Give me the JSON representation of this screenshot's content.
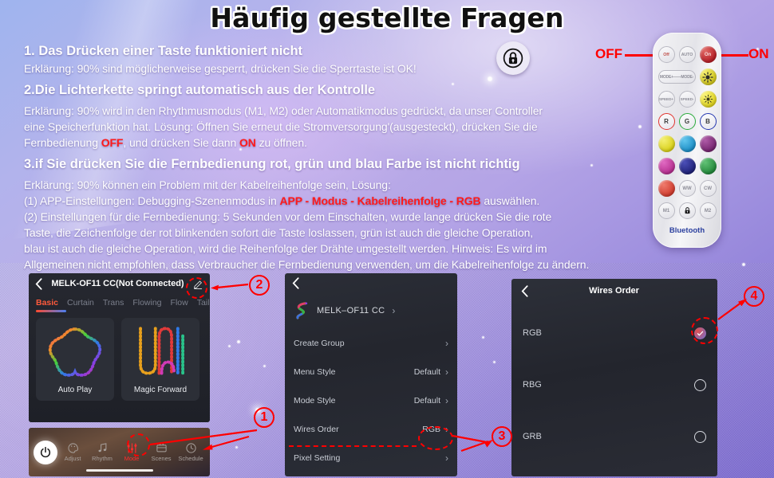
{
  "title": "Häufig gestellte Fragen",
  "faq": [
    {
      "heading": "1. Das Drücken einer Taste funktioniert nicht",
      "body": [
        "Erklärung: 90% sind möglicherweise gesperrt, drücken Sie die Sperrtaste ist OK!"
      ]
    },
    {
      "heading": "2.Die Lichterkette springt automatisch aus der Kontrolle",
      "body": [
        "Erklärung: 90% wird in den Rhythmusmodus (M1, M2) oder Automatikmodus gedrückt, da unser Controller",
        "eine Speicherfunktion hat. Lösung: Öffnen Sie erneut die Stromversorgung'(ausgesteckt), drücken Sie die",
        "Fernbedienung OFF, und drücken Sie dann ON zu öffnen."
      ],
      "highlight_off": "OFF",
      "highlight_on": "ON"
    },
    {
      "heading": "3.if Sie drücken Sie die Fernbedienung rot, grün und blau Farbe ist nicht richtig",
      "body": [
        "Erklärung: 90% können ein Problem mit der Kabelreihenfolge sein, Lösung:",
        "(1) APP-Einstellungen: Debugging-Szenenmodus in APP - Modus - Kabelreihenfolge - RGB auswählen.",
        "(2) Einstellungen für die Fernbedienung: 5 Sekunden vor dem Einschalten, wurde lange drücken Sie die rote",
        "Taste, die Zeichenfolge der rot blinkenden sofort die Taste loslassen, grün ist auch die gleiche Operation,",
        "blau ist auch die gleiche Operation, wird die Reihenfolge der Drähte umgestellt werden. Hinweis: Es wird im",
        "Allgemeinen nicht empfohlen, dass Verbraucher die Fernbedienung verwenden, um die Kabelreihenfolge zu ändern."
      ],
      "highlight_path": "APP - Modus - Kabelreihenfolge - RGB"
    }
  ],
  "lock_icon": "lock-icon",
  "remote": {
    "off_label": "OFF",
    "on_label": "ON",
    "brand": "Bluetooth",
    "rows": [
      {
        "buttons": [
          {
            "name": "off",
            "label": "Off",
            "style": "outline",
            "color": "#d04a4a"
          },
          {
            "name": "auto",
            "label": "AUTO",
            "style": "outline",
            "color": "#8d8d97"
          },
          {
            "name": "on",
            "label": "On",
            "style": "solid",
            "color": "#b61e26"
          }
        ]
      },
      {
        "buttons": [
          {
            "name": "mode-plus-minus",
            "label": "MODE+——MODE-",
            "style": "wide",
            "color": "#8d8d97"
          },
          {
            "name": "brightness-plus",
            "label": "",
            "style": "solid",
            "color": "#e8e12a"
          }
        ]
      },
      {
        "buttons": [
          {
            "name": "speed-plus",
            "label": "SPEED+",
            "style": "outline",
            "color": "#8d8d97"
          },
          {
            "name": "speed-minus",
            "label": "SPEED-",
            "style": "outline",
            "color": "#8d8d97"
          },
          {
            "name": "brightness-minus",
            "label": "",
            "style": "solid",
            "color": "#f0e726"
          }
        ]
      },
      {
        "buttons": [
          {
            "name": "red",
            "label": "R",
            "style": "rgbbtn",
            "color": "#e0342f"
          },
          {
            "name": "green",
            "label": "G",
            "style": "rgbbtn",
            "color": "#2bab3c"
          },
          {
            "name": "blue",
            "label": "B",
            "style": "rgbbtn",
            "color": "#2638b0"
          }
        ]
      },
      {
        "buttons": [
          {
            "name": "yellow",
            "label": "",
            "style": "solid",
            "color": "#e6e024"
          },
          {
            "name": "cyan",
            "label": "",
            "style": "solid",
            "color": "#23a4dd"
          },
          {
            "name": "purple",
            "label": "",
            "style": "solid",
            "color": "#8d3086"
          }
        ]
      },
      {
        "buttons": [
          {
            "name": "magenta",
            "label": "",
            "style": "solid",
            "color": "#cc3aa6"
          },
          {
            "name": "indigo",
            "label": "",
            "style": "solid",
            "color": "#2c2f90"
          },
          {
            "name": "green2",
            "label": "",
            "style": "solid",
            "color": "#32a54a"
          }
        ]
      },
      {
        "buttons": [
          {
            "name": "orange-red",
            "label": "",
            "style": "solid",
            "color": "#e0483c"
          },
          {
            "name": "warm-white",
            "label": "WW",
            "style": "outline",
            "color": "#8d8d97"
          },
          {
            "name": "cool-white",
            "label": "CW",
            "style": "outline",
            "color": "#8d8d97"
          }
        ]
      },
      {
        "buttons": [
          {
            "name": "m1",
            "label": "M1",
            "style": "outline",
            "color": "#8d8d97"
          },
          {
            "name": "lock",
            "label": "",
            "style": "outline",
            "color": "#222"
          },
          {
            "name": "m2",
            "label": "M2",
            "style": "outline",
            "color": "#8d8d97"
          }
        ]
      }
    ]
  },
  "phone1": {
    "back_icon": "chevron-left-icon",
    "header_title": "MELK-OF11  CC(Not Connected)",
    "edit_icon": "pencil-icon",
    "tabs": [
      {
        "label": "Basic",
        "active": true
      },
      {
        "label": "Curtain",
        "active": false
      },
      {
        "label": "Trans",
        "active": false
      },
      {
        "label": "Flowing",
        "active": false
      },
      {
        "label": "Flow",
        "active": false
      },
      {
        "label": "Tail",
        "active": false
      }
    ],
    "cards": [
      {
        "label": "Auto Play",
        "icon": "flower-pattern-icon"
      },
      {
        "label": "Magic Forward",
        "icon": "wave-pattern-icon"
      }
    ],
    "toolbar": {
      "power_icon": "power-icon",
      "items": [
        {
          "label": "Adjust",
          "icon": "palette-icon",
          "selected": false
        },
        {
          "label": "Rhythm",
          "icon": "music-note-icon",
          "selected": false
        },
        {
          "label": "Mode",
          "icon": "sliders-icon",
          "selected": true
        },
        {
          "label": "Scenes",
          "icon": "scenes-icon",
          "selected": false
        },
        {
          "label": "Schedule",
          "icon": "clock-icon",
          "selected": false
        }
      ]
    }
  },
  "phone2": {
    "back_icon": "chevron-left-icon",
    "device_name": "MELK–OF11   CC",
    "device_icon": "rainbow-strip-icon",
    "rows": [
      {
        "label": "Create Group",
        "value": ""
      },
      {
        "label": "Menu Style",
        "value": "Default"
      },
      {
        "label": "Mode Style",
        "value": "Default"
      },
      {
        "label": "Wires Order",
        "value": "RGB"
      },
      {
        "label": "Pixel Setting",
        "value": ""
      }
    ]
  },
  "phone3": {
    "back_icon": "chevron-left-icon",
    "title": "Wires Order",
    "options": [
      {
        "label": "RGB",
        "selected": true
      },
      {
        "label": "RBG",
        "selected": false
      },
      {
        "label": "GRB",
        "selected": false
      }
    ]
  },
  "callouts": [
    {
      "number": "1"
    },
    {
      "number": "2"
    },
    {
      "number": "3"
    },
    {
      "number": "4"
    }
  ],
  "colors": {
    "accent_red": "#ff0000",
    "tab_active": "#ff5a3c",
    "bluetooth_blue": "#2b3f9e"
  }
}
